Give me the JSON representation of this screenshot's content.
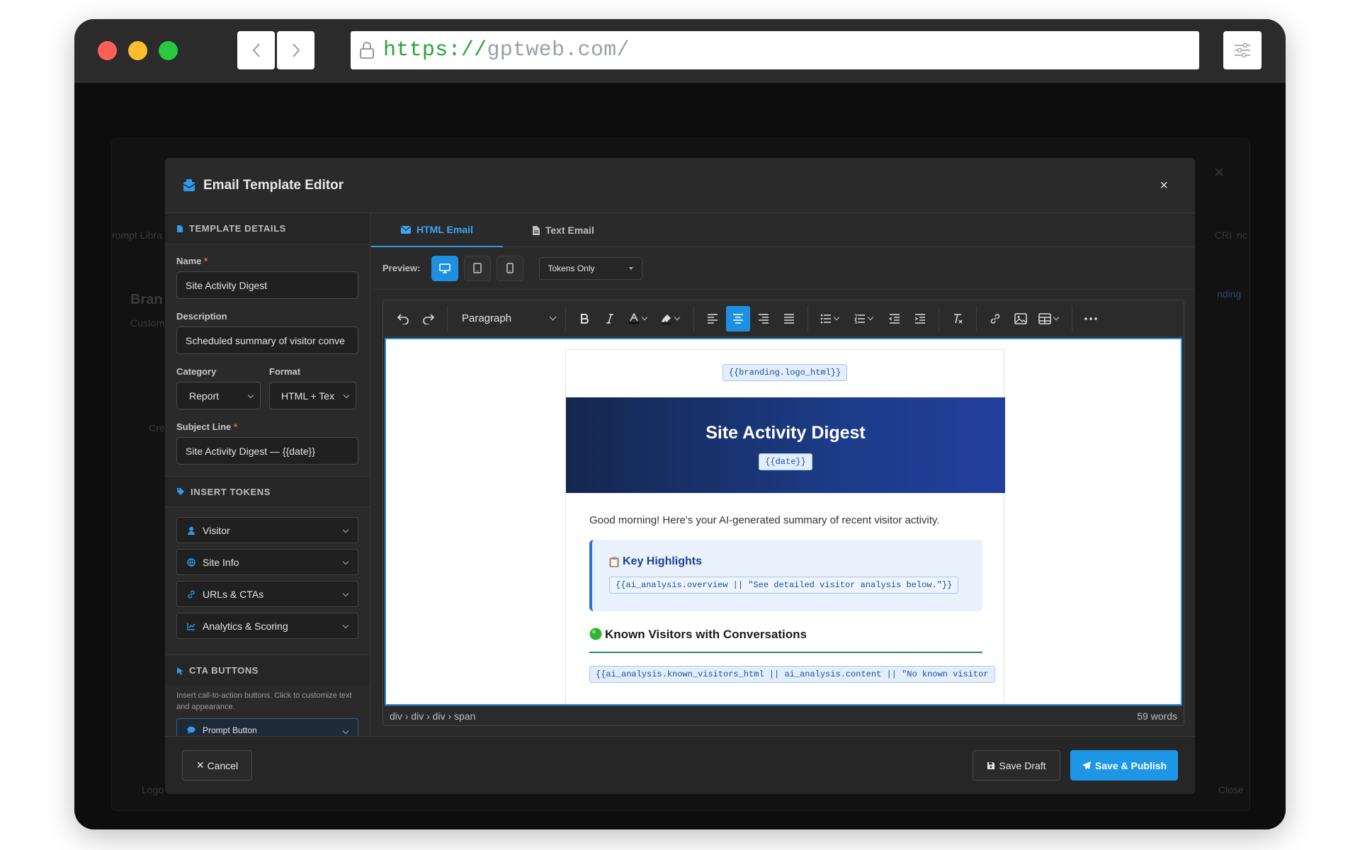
{
  "browser": {
    "url_scheme": "https://",
    "url_host": "gptweb.com/",
    "traffic_colors": {
      "close": "#ff5f57",
      "minimize": "#febc2e",
      "zoom": "#28c840"
    }
  },
  "background": {
    "fragment_brand": "Bran",
    "fragment_custom": "Custom",
    "fragment_prompt_lib": "rompt Libra",
    "fragment_cre": "Cre",
    "fragment_right": "CRI",
    "fragment_nc": "nc",
    "fragment_ending": "nding",
    "fragment_logo": "Logo",
    "fragment_close": "Close"
  },
  "modal": {
    "title": "Email Template Editor",
    "close_glyph": "×"
  },
  "sidebar": {
    "details_header": "TEMPLATE DETAILS",
    "name_label": "Name",
    "name_value": "Site Activity Digest",
    "description_label": "Description",
    "description_value": "Scheduled summary of visitor conve",
    "category_label": "Category",
    "category_value": "Report",
    "format_label": "Format",
    "format_value": "HTML + Tex",
    "subject_label": "Subject Line",
    "subject_value": "Site Activity Digest — {{date}}",
    "required_mark": "*",
    "tokens_header": "INSERT TOKENS",
    "token_groups": [
      "Visitor",
      "Site Info",
      "URLs & CTAs",
      "Analytics & Scoring"
    ],
    "cta_header": "CTA BUTTONS",
    "cta_help": "Insert call-to-action buttons. Click to customize text and appearance.",
    "cta_first": "Prompt Button"
  },
  "tabs": {
    "html_label": "HTML Email",
    "text_label": "Text Email"
  },
  "preview": {
    "label": "Preview:",
    "mode_select": "Tokens Only"
  },
  "toolbar": {
    "block_format": "Paragraph"
  },
  "email": {
    "logo_token": "{{branding.logo_html}}",
    "hero_title": "Site Activity Digest",
    "date_token": "{{date}}",
    "greeting": "Good morning! Here's your AI-generated summary of recent visitor activity.",
    "highlights_title": "Key Highlights",
    "overview_token": "{{ai_analysis.overview || \"See detailed visitor analysis below.\"}}",
    "known_heading": "Known Visitors with Conversations",
    "known_token": "{{ai_analysis.known_visitors_html || ai_analysis.content || \"No known visitor",
    "accent_color": "#1e90e0",
    "heading_rule_color": "#2e8b57"
  },
  "statusbar": {
    "path": [
      "div",
      "div",
      "div",
      "span"
    ],
    "path_text": "div › div › div › span",
    "word_count": "59 words"
  },
  "footer": {
    "cancel": "Cancel",
    "save_draft": "Save Draft",
    "save_publish": "Save & Publish"
  }
}
